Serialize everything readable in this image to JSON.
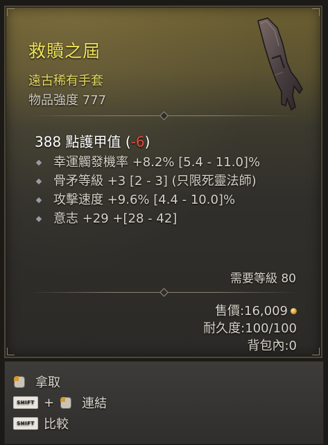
{
  "item": {
    "name": "救贖之屆",
    "rarity_type": "遠古稀有手套",
    "power_label": "物品強度",
    "power_value": "777",
    "armor_value": "388",
    "armor_label": "點護甲值",
    "armor_open": "(",
    "armor_delta": "-6",
    "armor_close": ")",
    "affixes": [
      "幸運觸發機率 +8.2% [5.4 - 11.0]%",
      "骨矛等級 +3 [2 - 3] (只限死靈法師)",
      "攻擊速度 +9.6% [4.4 - 10.0]%",
      "意志 +29 +[28 - 42]"
    ],
    "requirement": "需要等級 80",
    "sell_value": "售價:16,009",
    "durability": "耐久度:100/100",
    "in_bag": "背包內:0",
    "image_icon": "gloves-icon"
  },
  "hints": {
    "pickup": "拿取",
    "link": "連結",
    "compare": "比較",
    "shift_key": "SHIFT",
    "plus": "+"
  },
  "colors": {
    "name": "#f2e55a",
    "subtitle": "#e6da63",
    "negative": "#e24a3a"
  }
}
